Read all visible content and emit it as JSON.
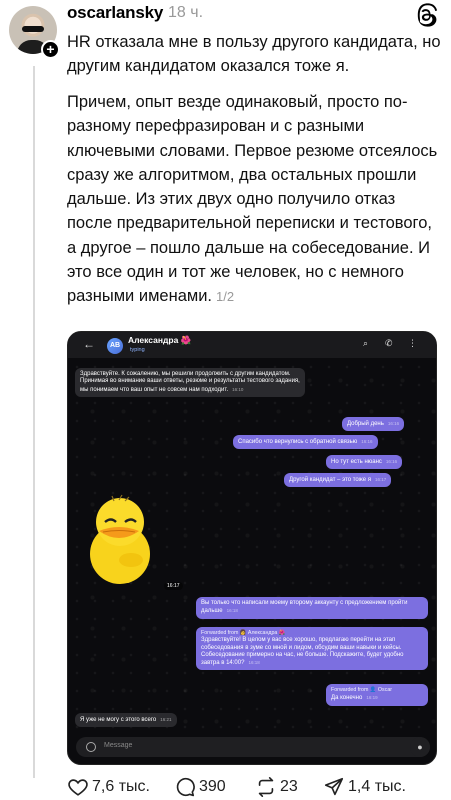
{
  "post": {
    "username": "oscarlansky",
    "time": "18 ч.",
    "paragraph1": "HR отказала мне в пользу другого кандидата, но другим кандидатом оказался тоже я.",
    "paragraph2": "Причем, опыт везде одинаковый, просто по-разному перефразирован и с разными ключевыми словами. Первое резюме отсеялось сразу же алгоритмом, два остальных прошли дальше. Из этих двух одно получило отказ после предварительной переписки и тестового, а другое – пошло дальше на собеседование. И это все один и тот же человек, но с немного разными именами.",
    "pager": "1/2"
  },
  "chat": {
    "contact_name": "Александра 🌺",
    "contact_initials": "АВ",
    "status": "typing",
    "msg1": "Здравствуйте. К сожалению, мы решили продолжить с другим кандидатом. Принимая во внимание ваши ответы, резюме и результаты тестового задания, мы понимаем что ваш опыт не совсем нам подходит.",
    "msg1_time": "16:10",
    "msg2": "Добрый день",
    "msg2_time": "16:16",
    "msg3": "Спасибо что вернулись с обратной связью",
    "msg3_time": "16:16",
    "msg4": "Но тут есть нюанс",
    "msg4_time": "16:16",
    "msg5": "Другой кандидат – это тоже я",
    "msg5_time": "16:17",
    "sticker_time": "16:17",
    "msg6": "Вы только что написали моему второму аккаунту с предложением пройти дальше",
    "msg6_time": "16:18",
    "fwd1_label": "Forwarded from 👩 Александра 🌺",
    "msg7": "Здравствуйте! В целом у вас все хорошо, предлагаю перейти на этап собеседования в зуме со мной и лидом, обсудим ваши навыки и кейсы. Собеседование примерно на час, не больше. Подскажите, будет удобно завтра в 14:00?",
    "msg7_time": "16:18",
    "fwd2_label": "Forwarded from 👤 Oscar",
    "msg8": "Да конечно",
    "msg8_time": "16:19",
    "msg9": "Я уже не могу с этого всего",
    "msg9_time": "16:21",
    "input_placeholder": "Message"
  },
  "actions": {
    "likes": "7,6 тыс.",
    "comments": "390",
    "reposts": "23",
    "shares": "1,4 тыс."
  }
}
